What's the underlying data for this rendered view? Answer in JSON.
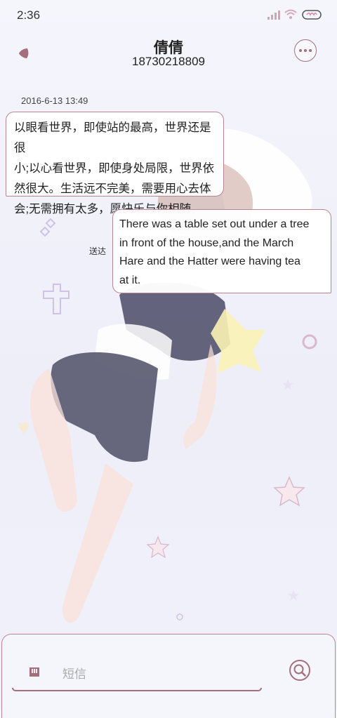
{
  "status_bar": {
    "time": "2:36",
    "icons": [
      "signal-icon",
      "wifi-icon",
      "battery-icon"
    ]
  },
  "header": {
    "contact_name": "倩倩",
    "contact_number": "18730218809",
    "back_icon": "back-icon",
    "more_icon": "more-icon"
  },
  "conversation": {
    "timestamp": "2016-6-13 13:49",
    "messages": [
      {
        "direction": "incoming",
        "lines": [
          "以眼看世界，即使站的最高，世界还是很",
          "小;以心看世界，即使身处局限，世界依",
          "然很大。生活远不完美，需要用心去体",
          "会;无需拥有太多，愿快乐与你相随。"
        ]
      },
      {
        "direction": "outgoing",
        "status": "送达",
        "lines": [
          "There was a table set out under a tree",
          "in front of the house,and the March",
          "Hare and the Hatter were having tea",
          "at it."
        ]
      }
    ]
  },
  "composer": {
    "placeholder": "短信",
    "attach_icon": "attach-icon",
    "send_icon": "send-icon"
  },
  "colors": {
    "accent": "#a46f7b",
    "bubble_border": "#b98590",
    "background": "#f3f3fb"
  }
}
